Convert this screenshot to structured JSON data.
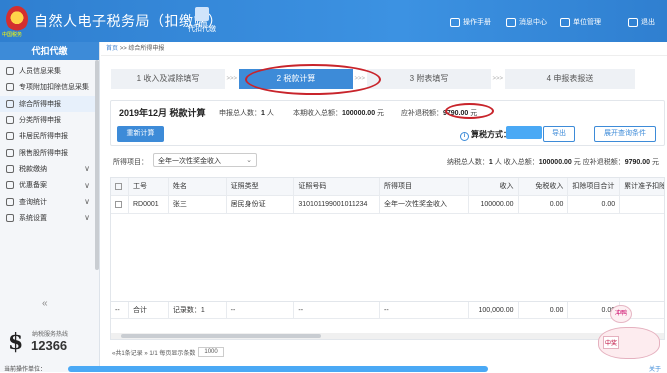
{
  "app": {
    "title": "自然人电子税务局（扣缴端）",
    "emblem_text": "中国税务",
    "top_function": "代扣代缴"
  },
  "top_right": [
    {
      "icon": "manual-icon",
      "label": "操作手册"
    },
    {
      "icon": "message-icon",
      "label": "消息中心"
    },
    {
      "icon": "unit-icon",
      "label": "单位管理"
    },
    {
      "icon": "exit-icon",
      "label": "退出"
    }
  ],
  "sidebar": {
    "header": "代扣代缴",
    "items": [
      {
        "label": "人员信息采集",
        "icon": "person-icon",
        "chevron": ""
      },
      {
        "label": "专项附加扣除信息采集",
        "icon": "doc-icon",
        "chevron": ""
      },
      {
        "label": "综合所得申报",
        "icon": "layers-icon",
        "chevron": "",
        "active": true
      },
      {
        "label": "分类所得申报",
        "icon": "chart-icon",
        "chevron": ""
      },
      {
        "label": "非居民所得申报",
        "icon": "globe-person-icon",
        "chevron": ""
      },
      {
        "label": "限售股所得申报",
        "icon": "lock-file-icon",
        "chevron": ""
      },
      {
        "label": "税款缴纳",
        "icon": "payment-icon",
        "chevron": "∨"
      },
      {
        "label": "优惠备案",
        "icon": "folder-icon",
        "chevron": "∨"
      },
      {
        "label": "查询统计",
        "icon": "search-stats-icon",
        "chevron": "∨"
      },
      {
        "label": "系统设置",
        "icon": "gear-icon",
        "chevron": "∨"
      }
    ],
    "collapse": "«",
    "hotline_label": "纳税服务热线",
    "hotline_number": "12366"
  },
  "breadcrumb": {
    "home": "首页",
    "sep": ">>",
    "current": "综合所得申报"
  },
  "steps": [
    {
      "label": "1 收入及减除填写",
      "active": false
    },
    {
      "label": "2 税款计算",
      "active": true
    },
    {
      "label": "3 附表填写",
      "active": false
    },
    {
      "label": "4 申报表报送",
      "active": false
    }
  ],
  "summary": {
    "title": "2019年12月 税款计算",
    "people_label": "申报总人数：",
    "people_value": "1",
    "people_unit": "人",
    "income_label": "本期收入总额：",
    "income_value": "100000.00",
    "income_unit": "元",
    "refund_label": "应补退税额：",
    "refund_value": "9790.00",
    "refund_unit": "元",
    "recalc_button": "重新计算",
    "calc_method_label": "算税方式：",
    "export_button": "导出",
    "expand_button": "展开查询条件"
  },
  "filter": {
    "label": "所得项目：",
    "selected": "全年一次性奖金收入",
    "people": "1",
    "income": "100000.00",
    "refund": "9790.00",
    "people_label": "纳税总人数：",
    "income_label": "收入总额：",
    "refund_label": "应补退税额：",
    "people_unit": "人",
    "income_unit": "元",
    "refund_unit": "元"
  },
  "table": {
    "headers": [
      "",
      "工号",
      "姓名",
      "证照类型",
      "证照号码",
      "所得项目",
      "收入",
      "免税收入",
      "扣除项目合计",
      "累计准予扣除"
    ],
    "rows": [
      [
        "",
        "RD0001",
        "张三",
        "居民身份证",
        "310101199001011234",
        "全年一次性奖金收入",
        "100000.00",
        "0.00",
        "0.00",
        ""
      ]
    ],
    "footer": [
      "--",
      "合计",
      "记录数：1",
      "--",
      "--",
      "--",
      "100,000.00",
      "0.00",
      "0.00",
      ""
    ]
  },
  "pager": {
    "text": "«共1条记录 » 1/1  每页显示条数",
    "size": "1000"
  },
  "status": {
    "left": "当前操作单位：",
    "right": "关于"
  },
  "mascot": {
    "top": "冲鸭",
    "bottom": "中奖"
  },
  "colors": {
    "primary": "#3d8bd8",
    "highlight": "#c8242b",
    "masked": "#4aa9f5"
  }
}
